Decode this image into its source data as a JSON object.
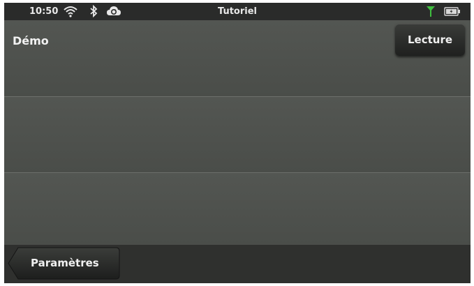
{
  "status_bar": {
    "time": "10:50",
    "title": "Tutoriel",
    "icons": [
      "wifi-icon",
      "bluetooth-icon",
      "cloud-sync-icon",
      "signal-icon",
      "battery-icon"
    ],
    "signal_color": "#3fbf3f"
  },
  "list": {
    "rows": [
      {
        "title": "Démo",
        "action_label": "Lecture"
      },
      {
        "title": ""
      },
      {
        "title": ""
      }
    ]
  },
  "bottom_bar": {
    "back_label": "Paramètres"
  }
}
